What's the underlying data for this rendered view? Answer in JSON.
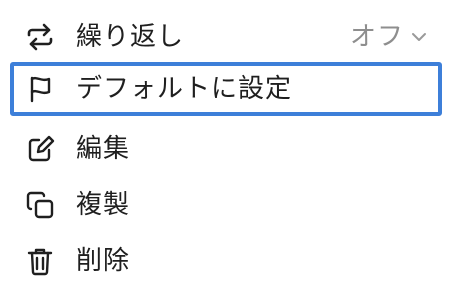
{
  "menu": {
    "items": [
      {
        "label": "繰り返し",
        "value": "オフ",
        "icon": "repeat-icon"
      },
      {
        "label": "デフォルトに設定",
        "icon": "flag-icon",
        "focused": true
      },
      {
        "label": "編集",
        "icon": "edit-icon"
      },
      {
        "label": "複製",
        "icon": "duplicate-icon"
      },
      {
        "label": "削除",
        "icon": "trash-icon"
      }
    ]
  },
  "colors": {
    "focus_border": "#3d7fd9",
    "text": "#1f1f1f",
    "secondary_text": "#8e8e8e"
  }
}
